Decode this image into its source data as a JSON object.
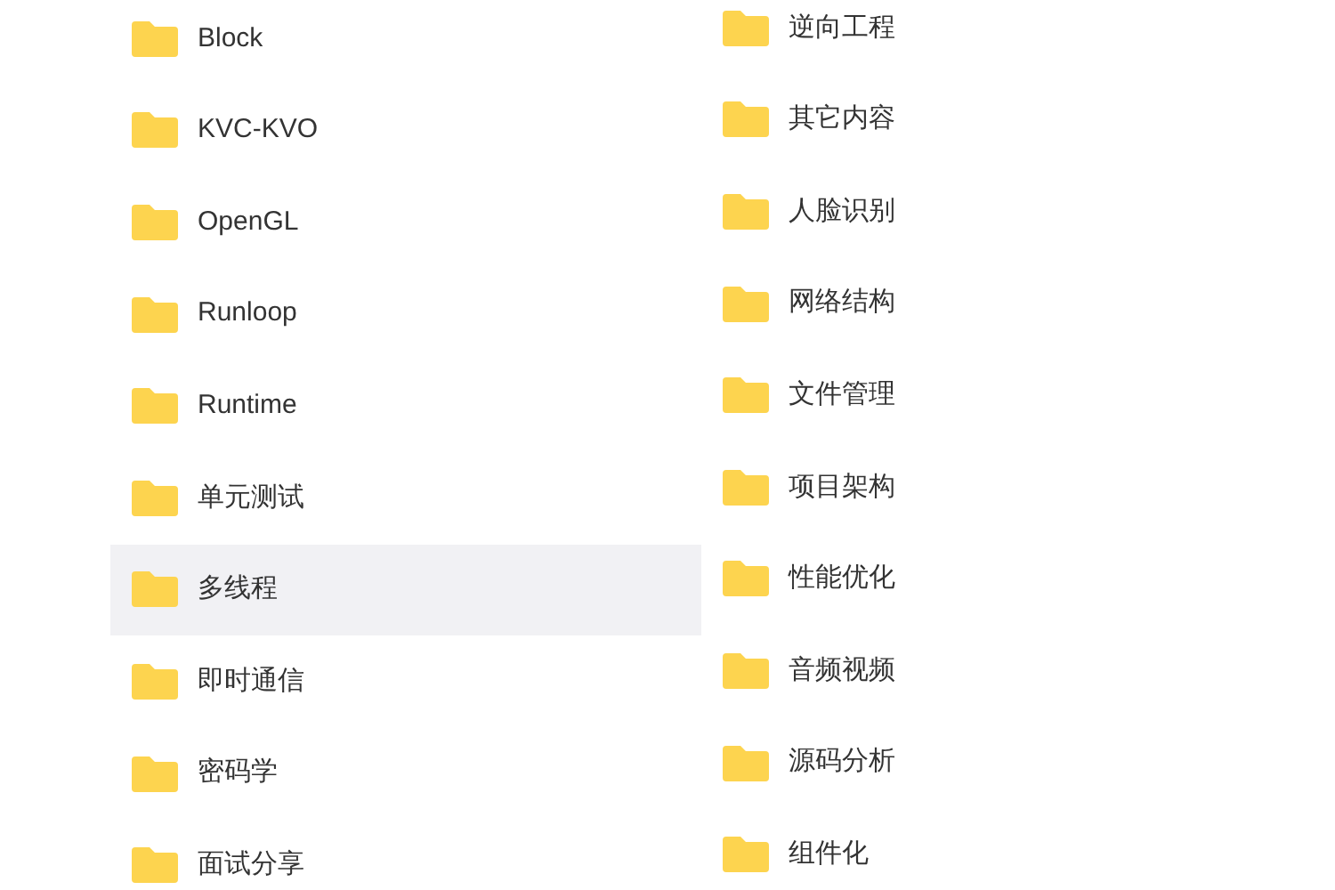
{
  "columns": [
    {
      "items": [
        {
          "name": "Block",
          "selected": false
        },
        {
          "name": "KVC-KVO",
          "selected": false
        },
        {
          "name": "OpenGL",
          "selected": false
        },
        {
          "name": "Runloop",
          "selected": false
        },
        {
          "name": "Runtime",
          "selected": false
        },
        {
          "name": "单元测试",
          "selected": false
        },
        {
          "name": "多线程",
          "selected": true
        },
        {
          "name": "即时通信",
          "selected": false
        },
        {
          "name": "密码学",
          "selected": false
        },
        {
          "name": "面试分享",
          "selected": false
        }
      ]
    },
    {
      "items": [
        {
          "name": "逆向工程",
          "selected": false
        },
        {
          "name": "其它内容",
          "selected": false
        },
        {
          "name": "人脸识别",
          "selected": false
        },
        {
          "name": "网络结构",
          "selected": false
        },
        {
          "name": "文件管理",
          "selected": false
        },
        {
          "name": "项目架构",
          "selected": false
        },
        {
          "name": "性能优化",
          "selected": false
        },
        {
          "name": "音频视频",
          "selected": false
        },
        {
          "name": "源码分析",
          "selected": false
        },
        {
          "name": "组件化",
          "selected": false
        }
      ]
    }
  ]
}
